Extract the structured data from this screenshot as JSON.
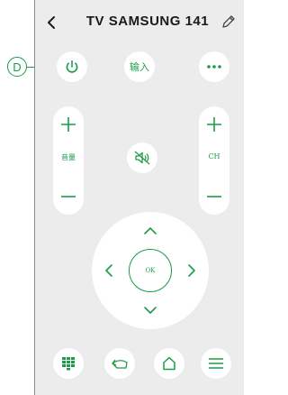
{
  "header": {
    "title": "TV SAMSUNG 141",
    "back_icon": "chevron-left-icon",
    "edit_icon": "pencil-icon"
  },
  "callout": {
    "label": "D"
  },
  "top_row": {
    "power_icon": "power-icon",
    "input_label": "输入",
    "more_icon": "more-horizontal-icon"
  },
  "volume": {
    "label": "音量"
  },
  "mute": {
    "icon": "mute-icon"
  },
  "channel": {
    "label": "CH"
  },
  "dpad": {
    "ok_label": "OK"
  },
  "bottom_row": {
    "icons": [
      "numpad-icon",
      "return-icon",
      "home-icon",
      "menu-icon"
    ]
  },
  "colors": {
    "accent": "#1e9b4a",
    "background": "#ececec",
    "button": "#ffffff",
    "title": "#1a1a1a"
  }
}
